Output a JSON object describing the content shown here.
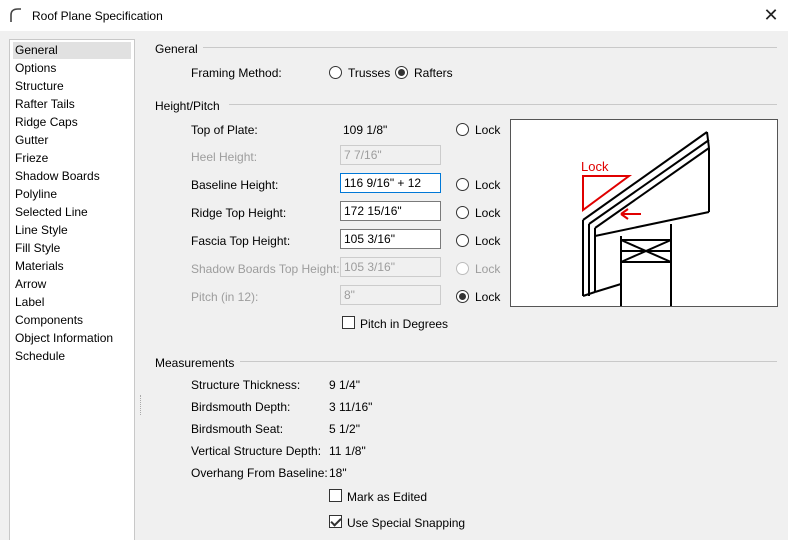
{
  "window": {
    "title": "Roof Plane Specification",
    "close_glyph": "✕"
  },
  "nav": [
    "General",
    "Options",
    "Structure",
    "Rafter Tails",
    "Ridge Caps",
    "Gutter",
    "Frieze",
    "Shadow Boards",
    "Polyline",
    "Selected Line",
    "Line Style",
    "Fill Style",
    "Materials",
    "Arrow",
    "Label",
    "Components",
    "Object Information",
    "Schedule"
  ],
  "general": {
    "header": "General",
    "framing_label": "Framing Method:",
    "trusses": "Trusses",
    "rafters": "Rafters",
    "selected": "Rafters"
  },
  "height_pitch": {
    "header": "Height/Pitch",
    "lock_label": "Lock",
    "rows": [
      {
        "label": "Top of Plate:",
        "value": "109 1/8\""
      },
      {
        "label": "Heel Height:",
        "value": "7 7/16\""
      },
      {
        "label": "Baseline Height:",
        "value": "116 9/16\" + 12"
      },
      {
        "label": "Ridge Top Height:",
        "value": "172 15/16\""
      },
      {
        "label": "Fascia Top Height:",
        "value": "105 3/16\""
      },
      {
        "label": "Shadow Boards Top Height:",
        "value": "105 3/16\""
      },
      {
        "label": "Pitch (in 12):",
        "value": "8\""
      }
    ],
    "pitch_degrees": "Pitch in Degrees"
  },
  "preview": {
    "lock_text": "Lock",
    "accent": "#e00000"
  },
  "measurements": {
    "header": "Measurements",
    "rows": [
      {
        "label": "Structure Thickness:",
        "value": "9 1/4\""
      },
      {
        "label": "Birdsmouth Depth:",
        "value": "3 11/16\""
      },
      {
        "label": "Birdsmouth Seat:",
        "value": "5 1/2\""
      },
      {
        "label": "Vertical Structure Depth:",
        "value": "11 1/8\""
      },
      {
        "label": "Overhang From Baseline:",
        "value": "18\""
      }
    ],
    "mark_edited": "Mark as Edited",
    "special_snapping": "Use Special Snapping"
  }
}
